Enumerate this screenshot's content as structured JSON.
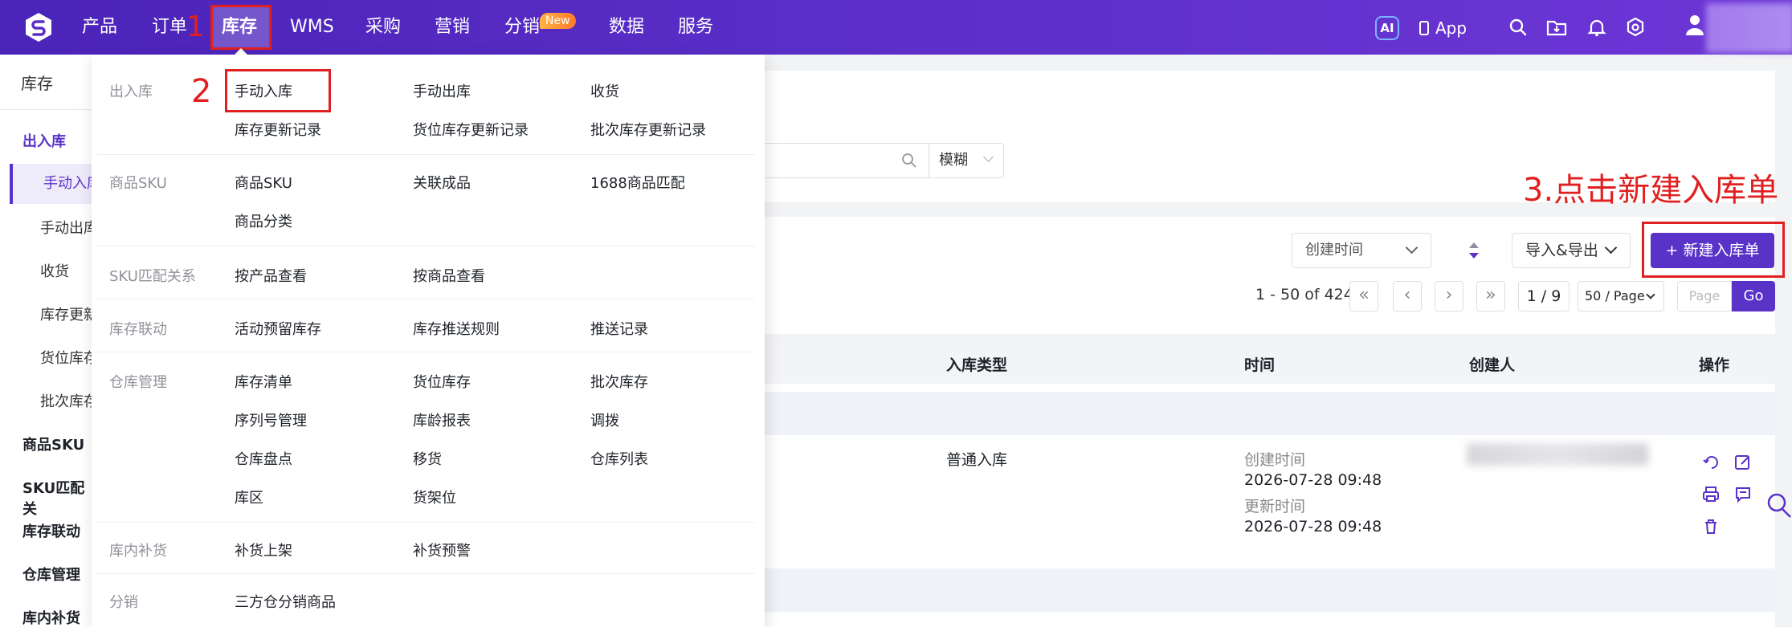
{
  "topnav": {
    "items": [
      "产品",
      "订单",
      "库存",
      "WMS",
      "采购",
      "营销",
      "分销",
      "数据",
      "服务"
    ],
    "active": "库存",
    "new_badge": "New",
    "ai_label": "AI",
    "app_label": "App"
  },
  "annotations": {
    "step1": "1",
    "step2": "2",
    "step3": "3.点击新建入库单"
  },
  "sidebar": {
    "title": "库存",
    "groups": [
      {
        "label": "出入库",
        "items": [
          "手动入库",
          "手动出库",
          "收货",
          "库存更新",
          "货位库存",
          "批次库存"
        ]
      },
      {
        "label": "商品SKU"
      },
      {
        "label": "SKU匹配关"
      },
      {
        "label": "库存联动"
      },
      {
        "label": "仓库管理"
      },
      {
        "label": "库内补货"
      }
    ]
  },
  "mega_menu": {
    "sections": [
      {
        "category": "出入库",
        "links": [
          "手动入库",
          "手动出库",
          "收货",
          "库存更新记录",
          "货位库存更新记录",
          "批次库存更新记录"
        ]
      },
      {
        "category": "商品SKU",
        "links": [
          "商品SKU",
          "关联成品",
          "1688商品匹配",
          "商品分类"
        ]
      },
      {
        "category": "SKU匹配关系",
        "links": [
          "按产品查看",
          "按商品查看"
        ]
      },
      {
        "category": "库存联动",
        "links": [
          "活动预留库存",
          "库存推送规则",
          "推送记录"
        ]
      },
      {
        "category": "仓库管理",
        "links": [
          "库存清单",
          "货位库存",
          "批次库存",
          "序列号管理",
          "库龄报表",
          "调拨",
          "仓库盘点",
          "移货",
          "仓库列表",
          "库区",
          "货架位"
        ]
      },
      {
        "category": "库内补货",
        "links": [
          "补货上架",
          "补货预警"
        ]
      },
      {
        "category": "分销",
        "links": [
          "三方仓分销商品"
        ]
      }
    ]
  },
  "filters": {
    "fuzzy_label": "模糊",
    "sort_label": "创建时间",
    "export_label": "导入&导出",
    "new_button": "新建入库单"
  },
  "pagination": {
    "summary": "1 - 50 of 424",
    "page": "1 / 9",
    "page_size": "50 / Page",
    "page_placeholder": "Page",
    "go_label": "Go"
  },
  "table": {
    "headers": [
      "入库类型",
      "时间",
      "创建人",
      "操作"
    ],
    "rows": [
      {
        "type": "普通入库",
        "created_label": "创建时间",
        "created": "2026-07-28 09:48",
        "updated_label": "更新时间",
        "updated": "2026-07-28 09:48"
      }
    ]
  },
  "colors": {
    "brand": "#5932c8",
    "annotation": "#e02020"
  }
}
